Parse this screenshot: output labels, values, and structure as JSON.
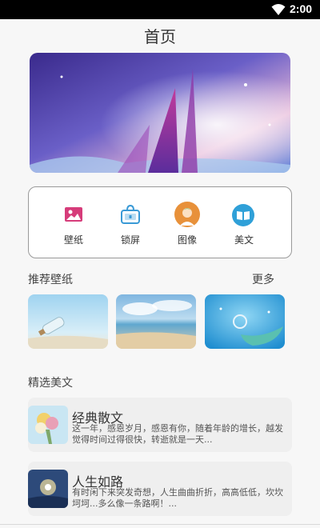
{
  "status_bar": {
    "time": "2:00"
  },
  "page": {
    "title": "首页"
  },
  "menu": {
    "items": [
      {
        "label": "壁纸",
        "icon": "image-icon",
        "color": "#d63c7a"
      },
      {
        "label": "锁屏",
        "icon": "lock-screen-icon",
        "color": "#3a9ad6"
      },
      {
        "label": "图像",
        "icon": "avatar-icon",
        "color": "#e8913a"
      },
      {
        "label": "美文",
        "icon": "book-icon",
        "color": "#2fa0d8"
      }
    ]
  },
  "recommended": {
    "title": "推荐壁纸",
    "more_label": "更多"
  },
  "featured": {
    "title": "精选美文",
    "articles": [
      {
        "title": "经典散文",
        "summary": "这一年，感恩岁月，感恩有你，随着年龄的增长，越发觉得时间过得很快，转逝就是一天..."
      },
      {
        "title": "人生如路",
        "summary": "有时闲下来突发奇想，人生曲曲折折，高高低低，坎坎坷坷...多么像一条路啊！..."
      }
    ]
  }
}
